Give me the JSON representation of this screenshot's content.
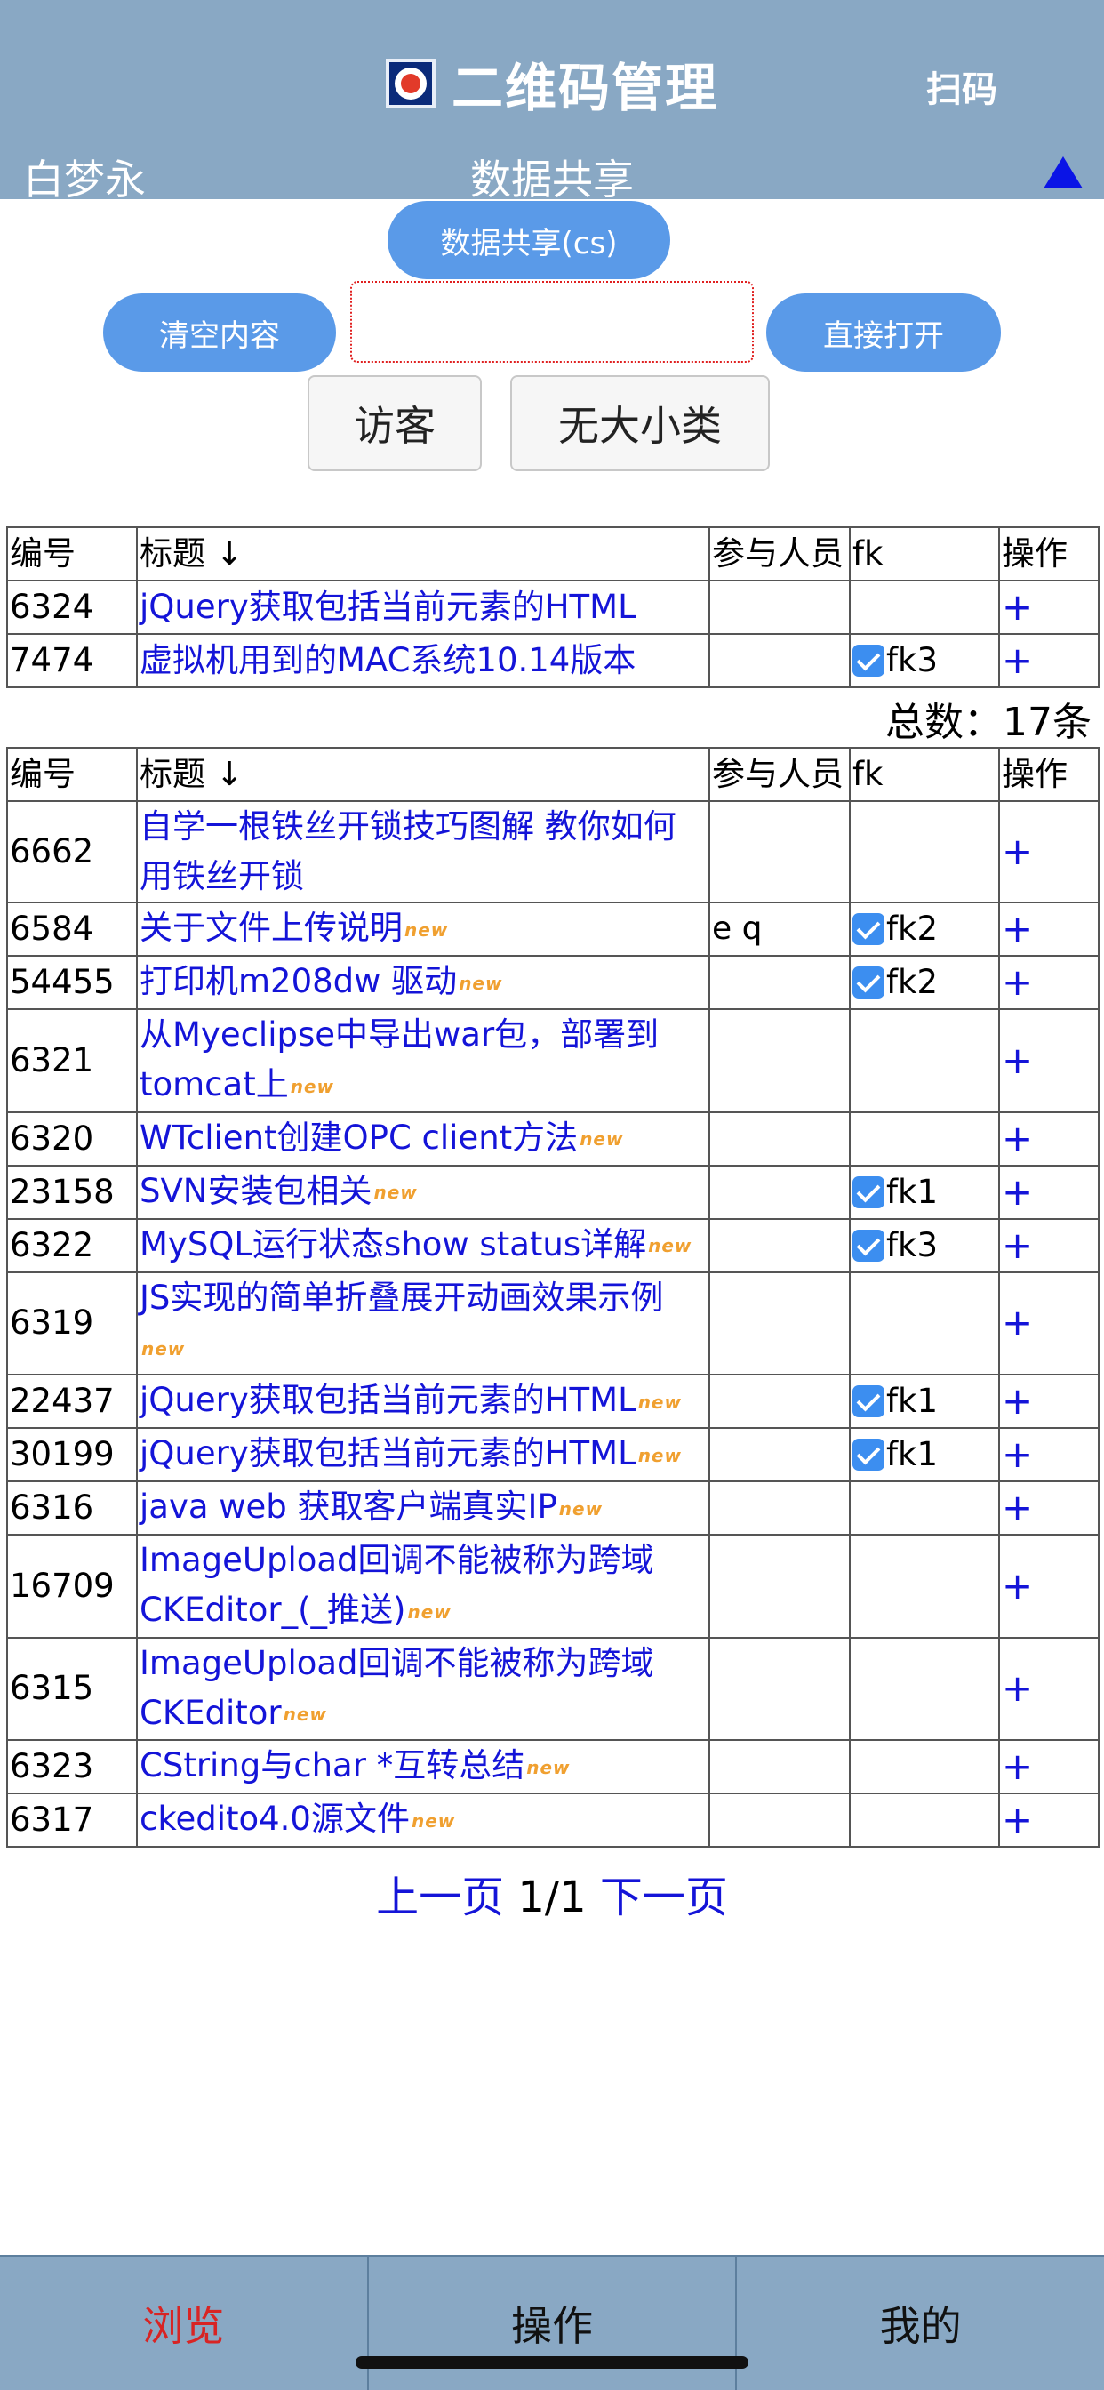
{
  "header": {
    "title": "二维码管理",
    "scan_label": "扫码",
    "user_name": "白梦永",
    "section_name": "数据共享"
  },
  "controls": {
    "share_label": "数据共享(cs)",
    "clear_label": "清空内容",
    "open_label": "直接打开",
    "input_value": "",
    "visitor_label": "访客",
    "category_label": "无大小类"
  },
  "table_headers": {
    "id": "编号",
    "title": "标题 ↓",
    "people": "参与人员",
    "fk": "fk",
    "op": "操作"
  },
  "new_badge": "new",
  "pinned_rows": [
    {
      "id": "6324",
      "title": "jQuery获取包括当前元素的HTML",
      "people": "",
      "fk": "",
      "checked": false,
      "op": "+",
      "is_new": false
    },
    {
      "id": "7474",
      "title": "虚拟机用到的MAC系统10.14版本",
      "people": "",
      "fk": "fk3",
      "checked": true,
      "op": "+",
      "is_new": false
    }
  ],
  "total_label": "总数：17条",
  "rows": [
    {
      "id": "6662",
      "title": "自学一根铁丝开锁技巧图解 教你如何用铁丝开锁",
      "people": "",
      "fk": "",
      "checked": false,
      "op": "+",
      "is_new": false
    },
    {
      "id": "6584",
      "title": "关于文件上传说明",
      "people": " e q",
      "fk": "fk2",
      "checked": true,
      "op": "+",
      "is_new": true
    },
    {
      "id": "54455",
      "title": "打印机m208dw 驱动",
      "people": "",
      "fk": "fk2",
      "checked": true,
      "op": "+",
      "is_new": true
    },
    {
      "id": "6321",
      "title": "从Myeclipse中导出war包，部署到tomcat上",
      "people": "",
      "fk": "",
      "checked": false,
      "op": "+",
      "is_new": true
    },
    {
      "id": "6320",
      "title": "WTclient创建OPC client方法",
      "people": "",
      "fk": "",
      "checked": false,
      "op": "+",
      "is_new": true
    },
    {
      "id": "23158",
      "title": "SVN安装包相关",
      "people": "",
      "fk": "fk1",
      "checked": true,
      "op": "+",
      "is_new": true
    },
    {
      "id": "6322",
      "title": "MySQL运行状态show status详解",
      "people": "",
      "fk": "fk3",
      "checked": true,
      "op": "+",
      "is_new": true
    },
    {
      "id": "6319",
      "title": "JS实现的简单折叠展开动画效果示例",
      "people": "",
      "fk": "",
      "checked": false,
      "op": "+",
      "is_new": true
    },
    {
      "id": "22437",
      "title": "jQuery获取包括当前元素的HTML",
      "people": "",
      "fk": "fk1",
      "checked": true,
      "op": "+",
      "is_new": true
    },
    {
      "id": "30199",
      "title": "jQuery获取包括当前元素的HTML",
      "people": "",
      "fk": "fk1",
      "checked": true,
      "op": "+",
      "is_new": true
    },
    {
      "id": "6316",
      "title": "java web 获取客户端真实IP",
      "people": "",
      "fk": "",
      "checked": false,
      "op": "+",
      "is_new": true
    },
    {
      "id": "16709",
      "title": "ImageUpload回调不能被称为跨域CKEditor_(_推送)",
      "people": "",
      "fk": "",
      "checked": false,
      "op": "+",
      "is_new": true
    },
    {
      "id": "6315",
      "title": "ImageUpload回调不能被称为跨域CKEditor",
      "people": "",
      "fk": "",
      "checked": false,
      "op": "+",
      "is_new": true
    },
    {
      "id": "6323",
      "title": "CString与char *互转总结",
      "people": "",
      "fk": "",
      "checked": false,
      "op": "+",
      "is_new": true
    },
    {
      "id": "6317",
      "title": "ckedito4.0源文件",
      "people": "",
      "fk": "",
      "checked": false,
      "op": "+",
      "is_new": true
    }
  ],
  "pager": {
    "prev_label": "上一页",
    "page_label": "1/1",
    "next_label": "下一页"
  },
  "bottom_nav": {
    "browse": "浏览",
    "operate": "操作",
    "mine": "我的"
  },
  "colors": {
    "header_bg": "#89a8c4",
    "button_blue": "#5a9ae8",
    "link_blue": "#1414d8",
    "active_red": "#d82424",
    "new_orange": "#f0a030"
  }
}
